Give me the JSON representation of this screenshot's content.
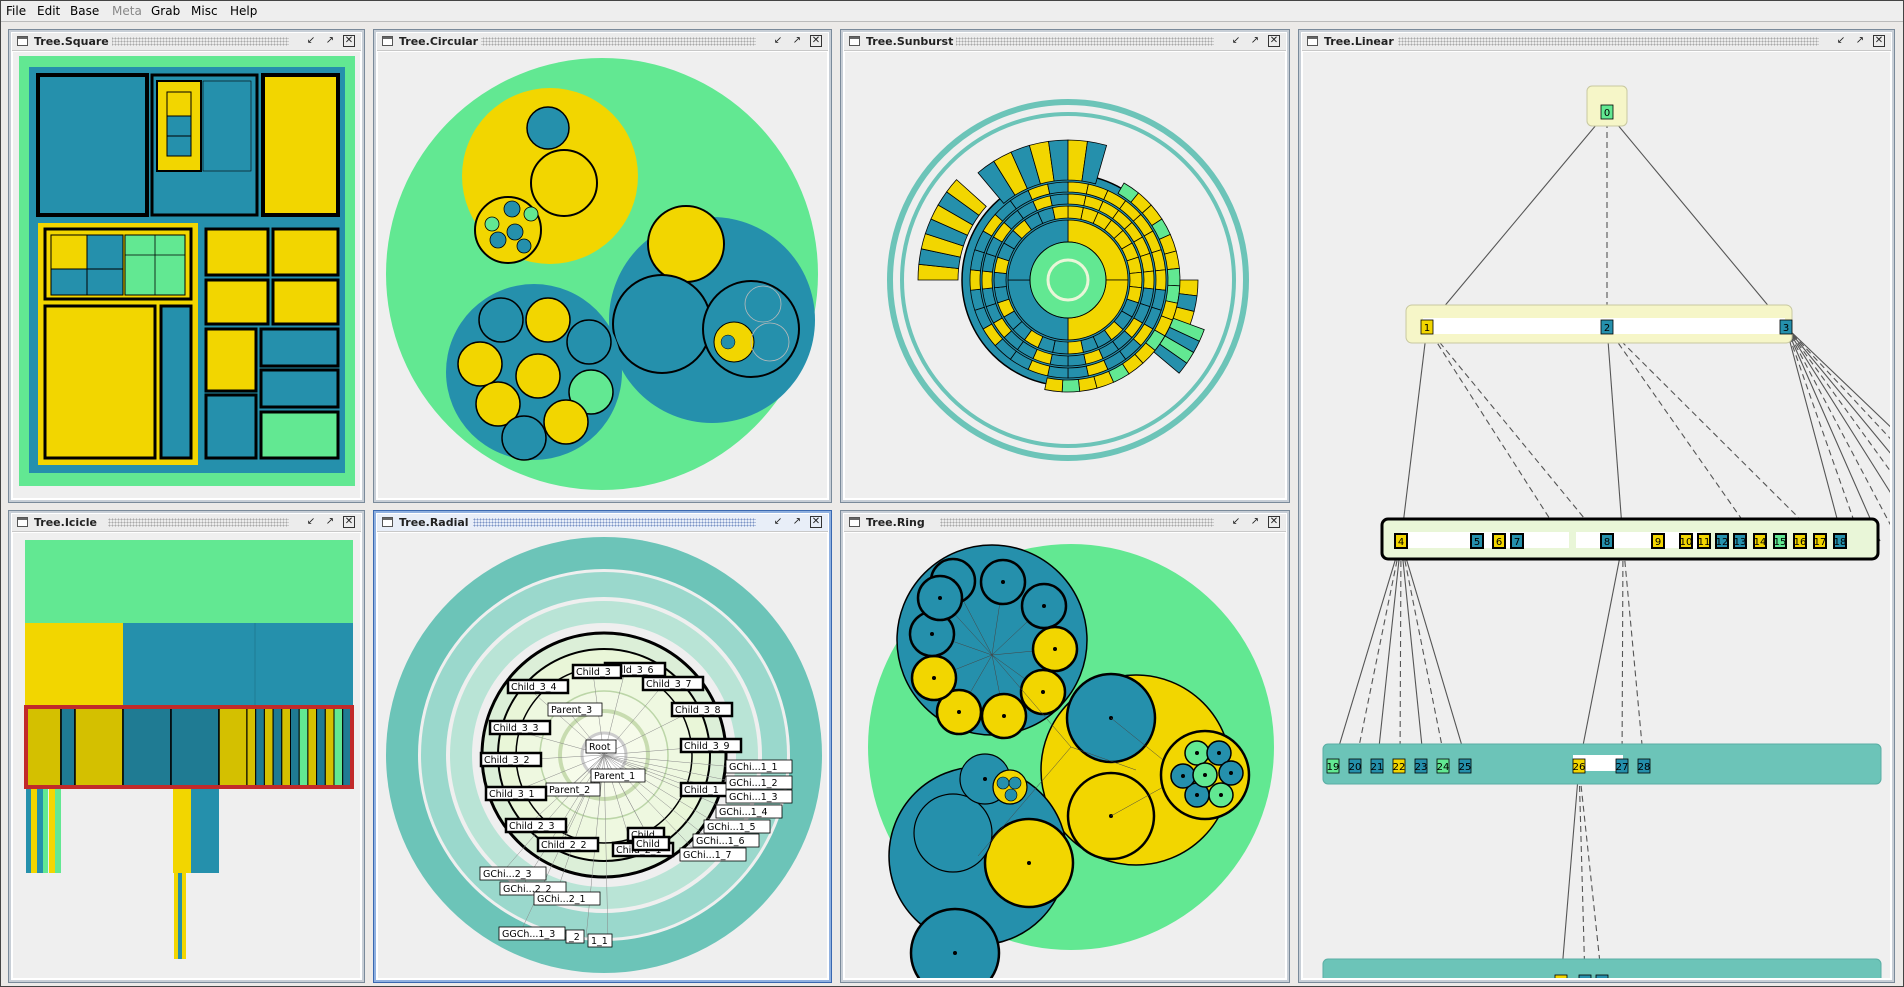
{
  "menubar": {
    "items": [
      {
        "label": "File",
        "enabled": true
      },
      {
        "label": "Edit",
        "enabled": true
      },
      {
        "label": "Base",
        "enabled": true
      },
      {
        "label": "Meta",
        "enabled": false
      },
      {
        "label": "Grab",
        "enabled": true
      },
      {
        "label": "Misc",
        "enabled": true
      },
      {
        "label": "Help",
        "enabled": true
      }
    ]
  },
  "windows": {
    "square": {
      "title": "Tree.Square"
    },
    "circular": {
      "title": "Tree.Circular"
    },
    "sunburst": {
      "title": "Tree.Sunburst"
    },
    "linear": {
      "title": "Tree.Linear"
    },
    "icicle": {
      "title": "Tree.Icicle"
    },
    "radial": {
      "title": "Tree.Radial"
    },
    "ring": {
      "title": "Tree.Ring"
    }
  },
  "window_controls": {
    "minimize_icon": "minimize-icon",
    "maximize_icon": "maximize-icon",
    "close_icon": "close-icon"
  },
  "colors": {
    "teal": "#2590ac",
    "yellow": "#f2d600",
    "light_green": "#62e892",
    "dark_outline": "#000000",
    "sea_green": "#6cc4b8",
    "pale_green": "#e9f6d8",
    "pale_yellow": "#f6f6c8",
    "highlight_red": "#c22a2a",
    "active_window": "#3a68b0"
  },
  "radial": {
    "labels": {
      "root": "Root",
      "parent_1": "Parent_1",
      "parent_2": "Parent_2",
      "parent_3": "Parent_3",
      "child_3_6": "Child_3_6",
      "child_3_7": "Child_3_7",
      "child_3_5": "Child_3",
      "child_3_4": "Child_3_4",
      "child_3_8": "Child_3_8",
      "child_3_3": "Child_3_3",
      "child_3_9": "Child_3_9",
      "child_3_2": "Child_3_2",
      "child_3_1": "Child_3_1",
      "child_2_3": "Child_2_3",
      "child_2_2": "Child_2_2",
      "child_2_1": "Child_2_1",
      "child_1_x": "Child_1",
      "child_a": "Child",
      "child_b": "Child",
      "gchi_1_1": "GChi...1_1",
      "gchi_1_2": "GChi...1_2",
      "gchi_1_3": "GChi...1_3",
      "gchi_1_4": "GChi...1_4",
      "gchi_1_5": "GChi...1_5",
      "gchi_1_6": "GChi...1_6",
      "gchi_1_7": "GChi...1_7",
      "gchi_2_3": "GChi...2_3",
      "gchi_2_2": "GChi...2_2",
      "gchi_2_1": "GChi...2_1",
      "ggch_1_3": "GGCh...1_3",
      "ggch_2": "_2",
      "ggch_1": "1_1"
    }
  },
  "linear": {
    "level0": [
      "0"
    ],
    "level1": [
      "1",
      "2",
      "3"
    ],
    "level2_group1": [
      "4",
      "5",
      "6"
    ],
    "level2_group2": [
      "7",
      "8",
      "9"
    ],
    "level2_group3": [
      "10",
      "11",
      "12",
      "13",
      "14",
      "15",
      "16",
      "17",
      "18"
    ],
    "level3_group1": [
      "19",
      "20",
      "21",
      "22",
      "23",
      "24",
      "25"
    ],
    "level3_group2": [
      "26",
      "27",
      "28"
    ],
    "level4": [
      "29",
      "30",
      "31"
    ]
  }
}
